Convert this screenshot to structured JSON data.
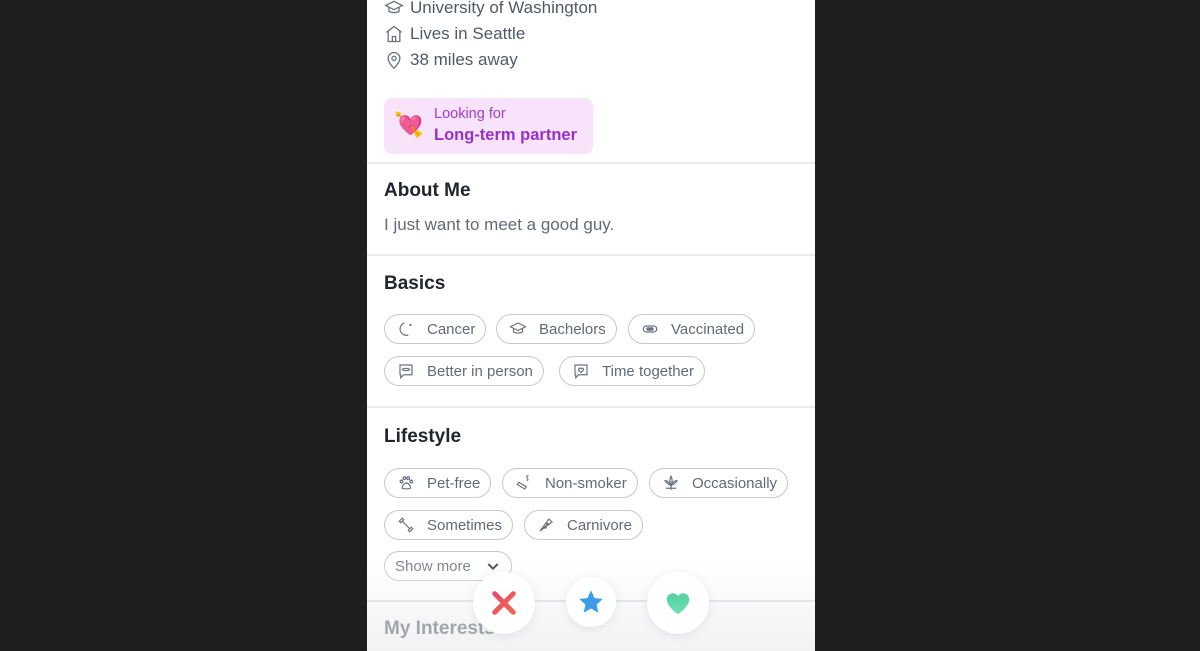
{
  "profile": {
    "info": [
      {
        "icon": "graduation-cap-icon",
        "text": "University of Washington"
      },
      {
        "icon": "house-icon",
        "text": "Lives in Seattle"
      },
      {
        "icon": "location-pin-icon",
        "text": "38 miles away"
      }
    ],
    "looking_for": {
      "emoji": "💘",
      "label": "Looking for",
      "value": "Long-term partner"
    }
  },
  "about": {
    "title": "About Me",
    "text": "I just want to meet a good guy."
  },
  "basics": {
    "title": "Basics",
    "chips": [
      {
        "icon": "moon-icon",
        "label": "Cancer"
      },
      {
        "icon": "graduation-cap-icon",
        "label": "Bachelors"
      },
      {
        "icon": "mask-icon",
        "label": "Vaccinated"
      },
      {
        "icon": "chat-lips-icon",
        "label": "Better in person"
      },
      {
        "icon": "chat-heart-icon",
        "label": "Time together"
      }
    ]
  },
  "lifestyle": {
    "title": "Lifestyle",
    "chips": [
      {
        "icon": "paw-icon",
        "label": "Pet-free"
      },
      {
        "icon": "cigarette-icon",
        "label": "Non-smoker"
      },
      {
        "icon": "cannabis-leaf-icon",
        "label": "Occasionally"
      },
      {
        "icon": "dumbbell-icon",
        "label": "Sometimes"
      },
      {
        "icon": "pizza-icon",
        "label": "Carnivore"
      }
    ],
    "show_more": "Show more"
  },
  "interests": {
    "title": "My Interests"
  },
  "actions": {
    "nope_color": "#e8505b",
    "super_like_color": "#3d9be9",
    "like_color": "#5fd9a5"
  }
}
